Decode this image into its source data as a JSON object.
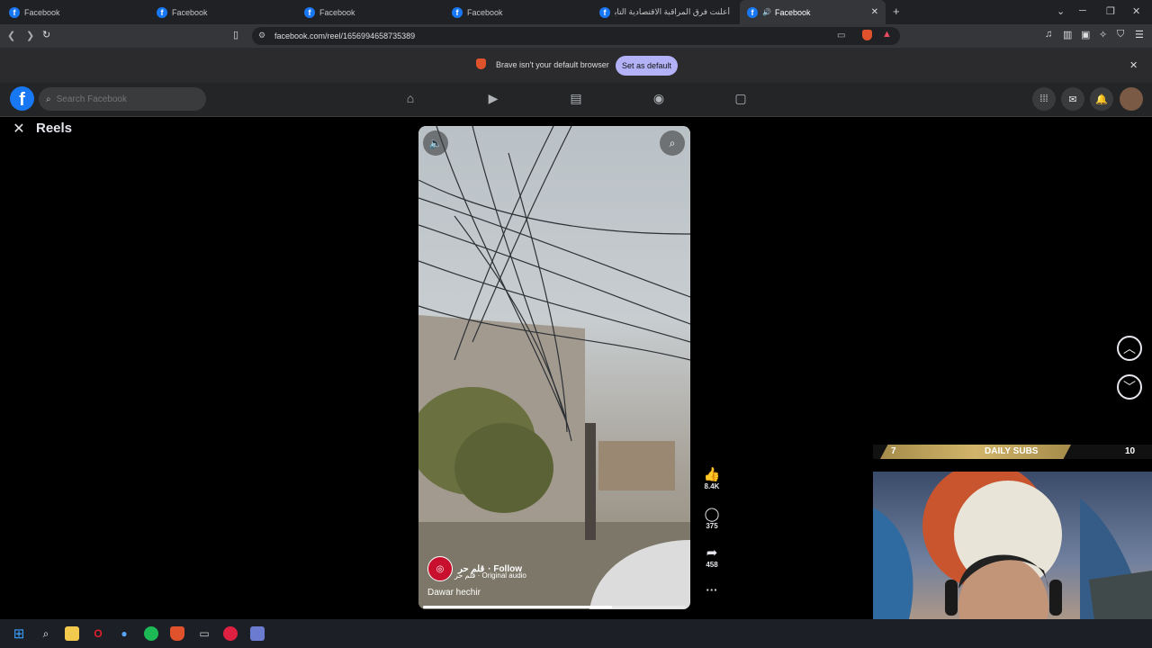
{
  "browser": {
    "tabs": [
      {
        "title": "Facebook"
      },
      {
        "title": "Facebook"
      },
      {
        "title": "Facebook"
      },
      {
        "title": "Facebook"
      },
      {
        "title": "أعلنت فرق المراقبة الاقتصادية التابعة..."
      },
      {
        "title": "Facebook",
        "active": true
      }
    ],
    "new_tab": "+",
    "url": "facebook.com/reel/1656994658735389",
    "infobar": {
      "message": "Brave isn't your default browser",
      "button": "Set as default"
    }
  },
  "facebook": {
    "logo": "f",
    "search_placeholder": "Search Facebook",
    "nav_icons": [
      "home-icon",
      "video-icon",
      "feeds-icon",
      "groups-icon",
      "gaming-icon"
    ],
    "right_icons": [
      "menu-grid-icon",
      "messenger-icon",
      "notifications-icon",
      "profile-avatar"
    ]
  },
  "reels": {
    "title": "Reels",
    "owner": "قلم حر",
    "follow": "· Follow",
    "audio": "قلم حر · Original audio",
    "caption": "Dawar hechir",
    "progress": 0.72,
    "likes": "8.4K",
    "comments": "375",
    "shares": "458",
    "more": "···"
  },
  "stream_overlay": {
    "left_count": "7",
    "title": "DAILY SUBS",
    "right_count": "10"
  },
  "colors": {
    "fb_blue": "#1877f2",
    "header_bg": "#242526",
    "infobar_button": "#b3b2f7",
    "subs_gold": "#d2b56a"
  }
}
